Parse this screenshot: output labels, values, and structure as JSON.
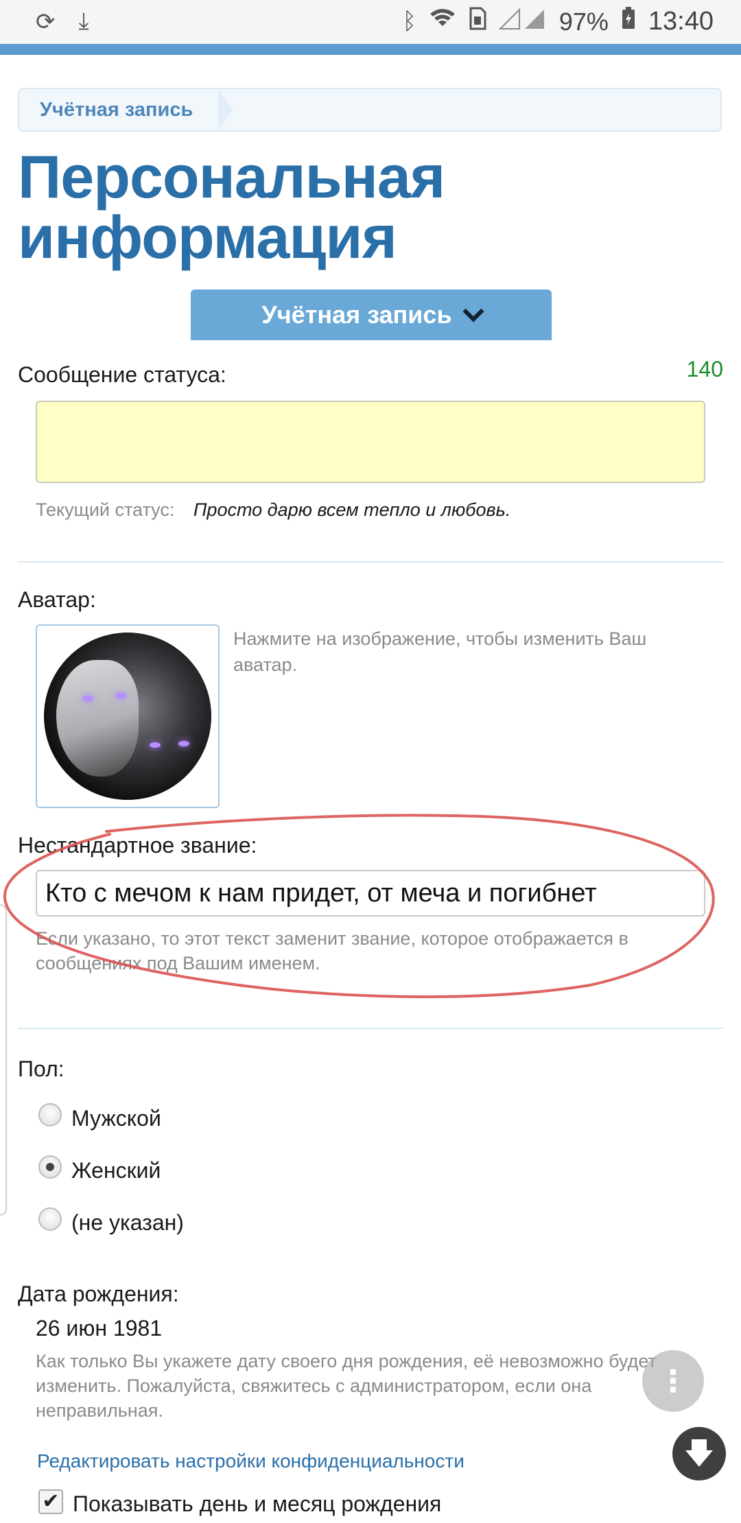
{
  "status_bar": {
    "battery": "97%",
    "time": "13:40"
  },
  "breadcrumb": {
    "item": "Учётная запись"
  },
  "page": {
    "title_line1": "Персональная",
    "title_line2": "информация",
    "section_select": "Учётная запись"
  },
  "status_message": {
    "label": "Сообщение статуса:",
    "counter": "140",
    "value": "",
    "current_label": "Текущий статус:",
    "current_value": "Просто дарю всем тепло и любовь."
  },
  "avatar": {
    "label": "Аватар:",
    "hint": "Нажмите на изображение, чтобы изменить Ваш аватар."
  },
  "custom_title": {
    "label": "Нестандартное звание:",
    "value": "Кто с мечом к нам придет, от меча и погибнет",
    "hint": "Если указано, то этот текст заменит звание, которое отображается в сообщениях под Вашим именем."
  },
  "gender": {
    "label": "Пол:",
    "options": [
      {
        "label": "Мужской",
        "checked": false
      },
      {
        "label": "Женский",
        "checked": true
      },
      {
        "label": "(не указан)",
        "checked": false
      }
    ]
  },
  "birthday": {
    "label": "Дата рождения:",
    "value": "26 июн 1981",
    "hint": "Как только Вы укажете дату своего дня рождения, её невозможно будет изменить. Пожалуйста, свяжитесь с администратором, если она неправильная.",
    "privacy_link": "Редактировать настройки конфиденциальности",
    "show_day_month_label": "Показывать день и месяц рождения",
    "show_day_month_checked": true
  },
  "colors": {
    "accent": "#2a6fa8",
    "status_input_bg": "#ffffc6",
    "counter": "#1f8a2c",
    "annotation": "#d9534f"
  },
  "icons": [
    "sync-icon",
    "download-icon",
    "bluetooth-icon",
    "wifi-icon",
    "sim-icon",
    "signal-icon",
    "battery-icon",
    "chevron-down-icon",
    "more-vert-icon",
    "arrow-down-icon",
    "checkmark-icon"
  ]
}
